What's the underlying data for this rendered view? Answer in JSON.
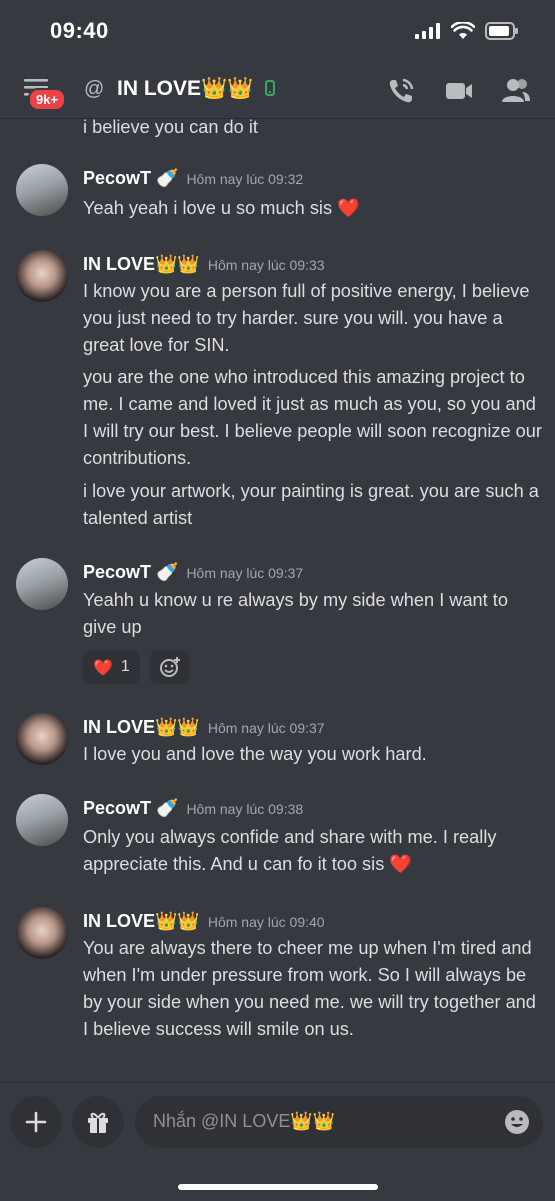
{
  "status_bar": {
    "time": "09:40"
  },
  "header": {
    "badge": "9k+",
    "at_symbol": "@",
    "title": "IN LOVE👑👑"
  },
  "messages": {
    "partial_text": "i believe you can do it",
    "m1": {
      "author": "PecowT 🍼",
      "timestamp": "Hôm nay lúc 09:32",
      "text": "Yeah yeah i love u so much sis ❤️"
    },
    "m2": {
      "author": "IN LOVE👑👑",
      "timestamp": "Hôm nay lúc 09:33",
      "text1": "I know you are a person full of positive energy, I believe you just need to try harder.  sure you will. you have a great love for SIN.",
      "text2": "you are the one who introduced this amazing project to me.  I came and loved it just as much as you, so you and I will try our best.  I believe people will soon recognize our contributions.",
      "text3": "i love your artwork, your painting is great.  you are such a talented artist"
    },
    "m3": {
      "author": "PecowT 🍼",
      "timestamp": "Hôm nay lúc 09:37",
      "text": "Yeahh u know u re always by my side when I want to give up",
      "reaction_emoji": "❤️",
      "reaction_count": "1"
    },
    "m4": {
      "author": "IN LOVE👑👑",
      "timestamp": "Hôm nay lúc 09:37",
      "text": "I love you and love the way you work hard."
    },
    "m5": {
      "author": "PecowT 🍼",
      "timestamp": "Hôm nay lúc 09:38",
      "text": "Only you always confide and share with me. I really appreciate this. And u can fo it too sis ❤️"
    },
    "m6": {
      "author": "IN LOVE👑👑",
      "timestamp": "Hôm nay lúc 09:40",
      "text": "You are always there to cheer me up when I'm tired and when I'm under pressure from work.  So I will always be by your side when you need me.  we will try together and I believe success will smile on us."
    }
  },
  "composer": {
    "placeholder": "Nhắn @IN LOVE👑👑"
  },
  "colors": {
    "background": "#36393f",
    "text": "#dcddde",
    "badge": "#ed4245",
    "online": "#3ba55d"
  },
  "icons": [
    "hamburger-icon",
    "phone-call-icon",
    "video-icon",
    "members-icon",
    "plus-icon",
    "gift-icon",
    "emoji-icon",
    "add-reaction-icon",
    "mobile-status-icon"
  ]
}
